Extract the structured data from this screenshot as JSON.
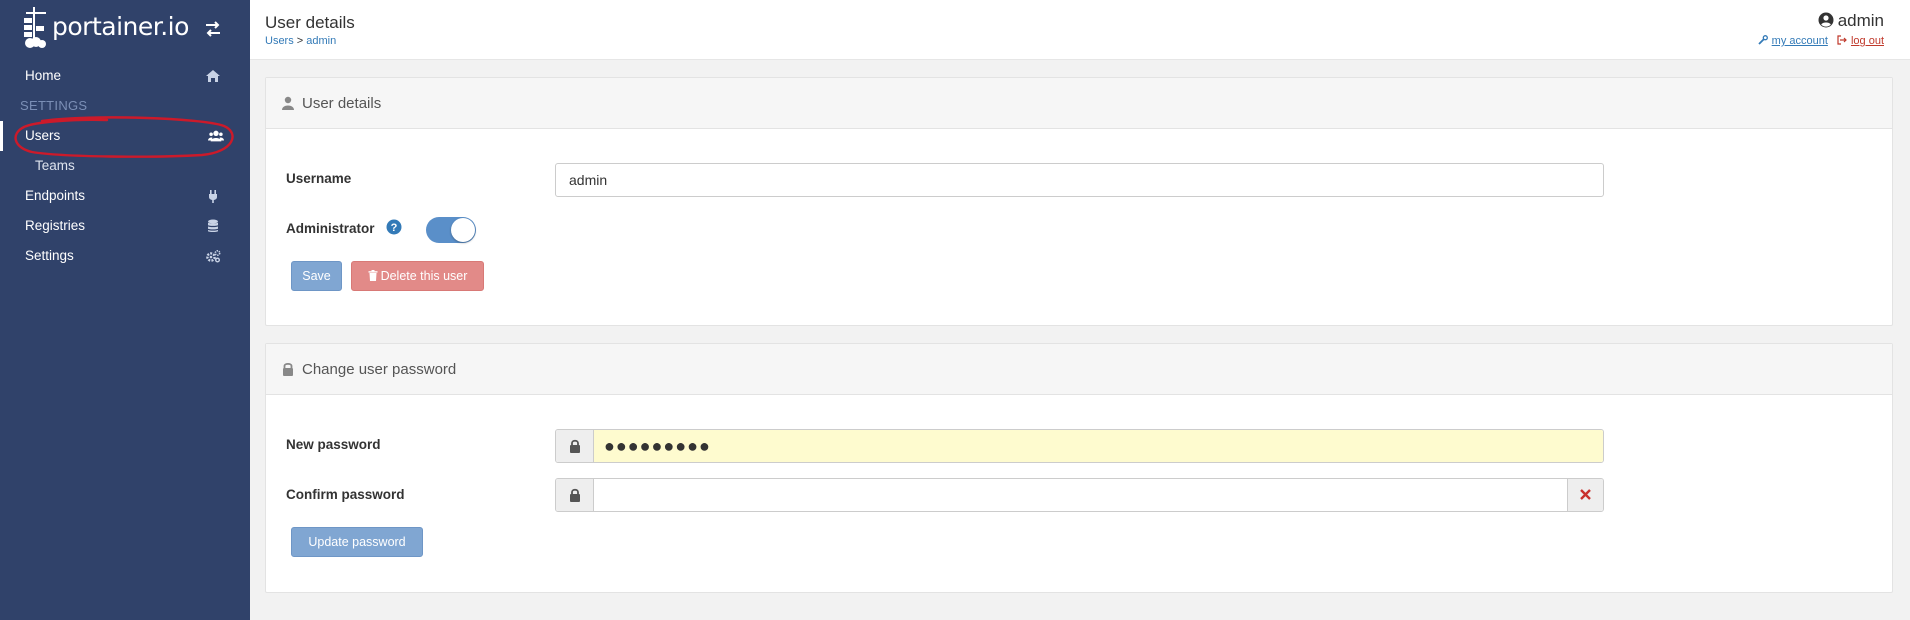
{
  "brand": {
    "name": "portainer.io"
  },
  "sidebar": {
    "items": [
      {
        "label": "Home",
        "icon": "home-icon"
      },
      {
        "label": "Users",
        "icon": "users-icon"
      },
      {
        "label": "Teams"
      },
      {
        "label": "Endpoints",
        "icon": "plug-icon"
      },
      {
        "label": "Registries",
        "icon": "database-icon"
      },
      {
        "label": "Settings",
        "icon": "cogs-icon"
      }
    ],
    "section_heading": "SETTINGS"
  },
  "header": {
    "title": "User details",
    "breadcrumb": {
      "parent": "Users",
      "separator": " > ",
      "current": "admin"
    },
    "username": "admin",
    "my_account": "my account",
    "log_out": "log out"
  },
  "user_details": {
    "title": "User details",
    "username_label": "Username",
    "username_value": "admin",
    "admin_label": "Administrator",
    "admin_enabled": true,
    "save_label": "Save",
    "delete_label": "Delete this user"
  },
  "change_password": {
    "title": "Change user password",
    "new_label": "New password",
    "new_value": "●●●●●●●●●",
    "confirm_label": "Confirm password",
    "confirm_value": "",
    "update_label": "Update password"
  },
  "colors": {
    "sidebar_bg": "#30426a",
    "primary": "#80a6d2",
    "danger": "#e28a88",
    "annotation": "#cc1a2a",
    "autofill": "#fefbcf"
  }
}
